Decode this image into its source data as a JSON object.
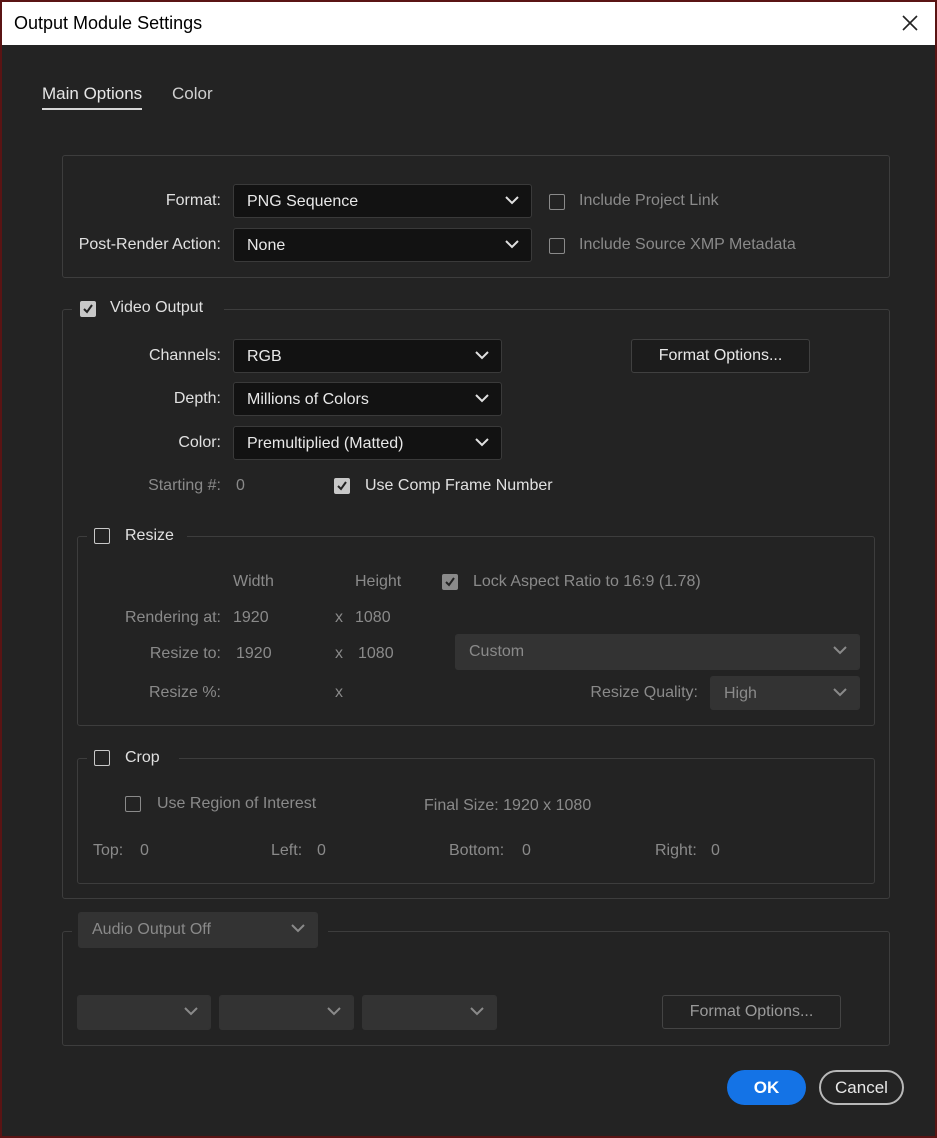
{
  "window": {
    "title": "Output Module Settings"
  },
  "tabs": [
    {
      "label": "Main Options"
    },
    {
      "label": "Color"
    }
  ],
  "format_section": {
    "format_label": "Format:",
    "format_value": "PNG Sequence",
    "post_render_label": "Post-Render Action:",
    "post_render_value": "None",
    "include_project_link": {
      "label": "Include Project Link",
      "checked": false
    },
    "include_xmp": {
      "label": "Include Source XMP Metadata",
      "checked": false
    }
  },
  "video_output": {
    "label": "Video Output",
    "checked": true,
    "channels_label": "Channels:",
    "channels_value": "RGB",
    "depth_label": "Depth:",
    "depth_value": "Millions of Colors",
    "color_label": "Color:",
    "color_value": "Premultiplied (Matted)",
    "format_options_label": "Format Options...",
    "starting_label": "Starting #:",
    "starting_value": "0",
    "use_comp_frame": {
      "label": "Use Comp Frame Number",
      "checked": true
    }
  },
  "resize": {
    "label": "Resize",
    "checked": false,
    "width_header": "Width",
    "height_header": "Height",
    "lock_aspect": {
      "label": "Lock Aspect Ratio to 16:9 (1.78)",
      "checked": true
    },
    "rendering_label": "Rendering at:",
    "rendering_width": "1920",
    "rendering_height": "1080",
    "resize_to_label": "Resize to:",
    "resize_to_width": "1920",
    "resize_to_height": "1080",
    "x_sep": "x",
    "preset_value": "Custom",
    "percent_label": "Resize %:",
    "quality_label": "Resize Quality:",
    "quality_value": "High"
  },
  "crop": {
    "label": "Crop",
    "checked": false,
    "use_roi": {
      "label": "Use Region of Interest",
      "checked": false
    },
    "final_size": "Final Size: 1920 x 1080",
    "top_label": "Top:",
    "top_value": "0",
    "left_label": "Left:",
    "left_value": "0",
    "bottom_label": "Bottom:",
    "bottom_value": "0",
    "right_label": "Right:",
    "right_value": "0"
  },
  "audio": {
    "output_value": "Audio Output Off",
    "format_options_label": "Format Options..."
  },
  "footer": {
    "ok_label": "OK",
    "cancel_label": "Cancel"
  },
  "colors": {
    "accent": "#1473e6",
    "background": "#232323",
    "field": "#121212"
  }
}
